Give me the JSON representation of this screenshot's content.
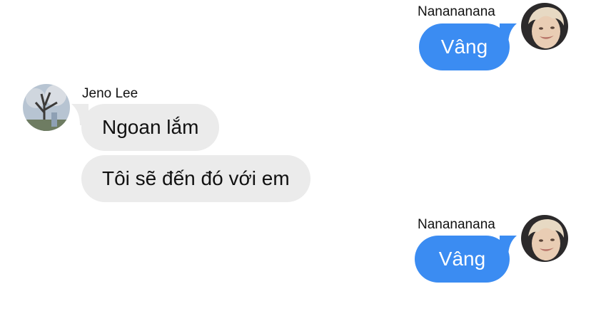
{
  "conversation": {
    "messages": [
      {
        "sender": "Nanananana",
        "text": "Vâng",
        "direction": "outgoing",
        "avatar_icon": "boy-portrait-avatar"
      },
      {
        "sender": "Jeno Lee",
        "text": "Ngoan lắm",
        "direction": "incoming",
        "avatar_icon": "tree-photo-avatar"
      },
      {
        "sender": "Jeno Lee",
        "text": "Tôi sẽ đến đó với em",
        "direction": "incoming"
      },
      {
        "sender": "Nanananana",
        "text": "Vâng",
        "direction": "outgoing",
        "avatar_icon": "boy-portrait-avatar"
      }
    ]
  },
  "colors": {
    "outgoing_bubble": "#3b8cf2",
    "incoming_bubble": "#ebebeb",
    "outgoing_text": "#ffffff",
    "incoming_text": "#111111",
    "background": "#ffffff"
  }
}
